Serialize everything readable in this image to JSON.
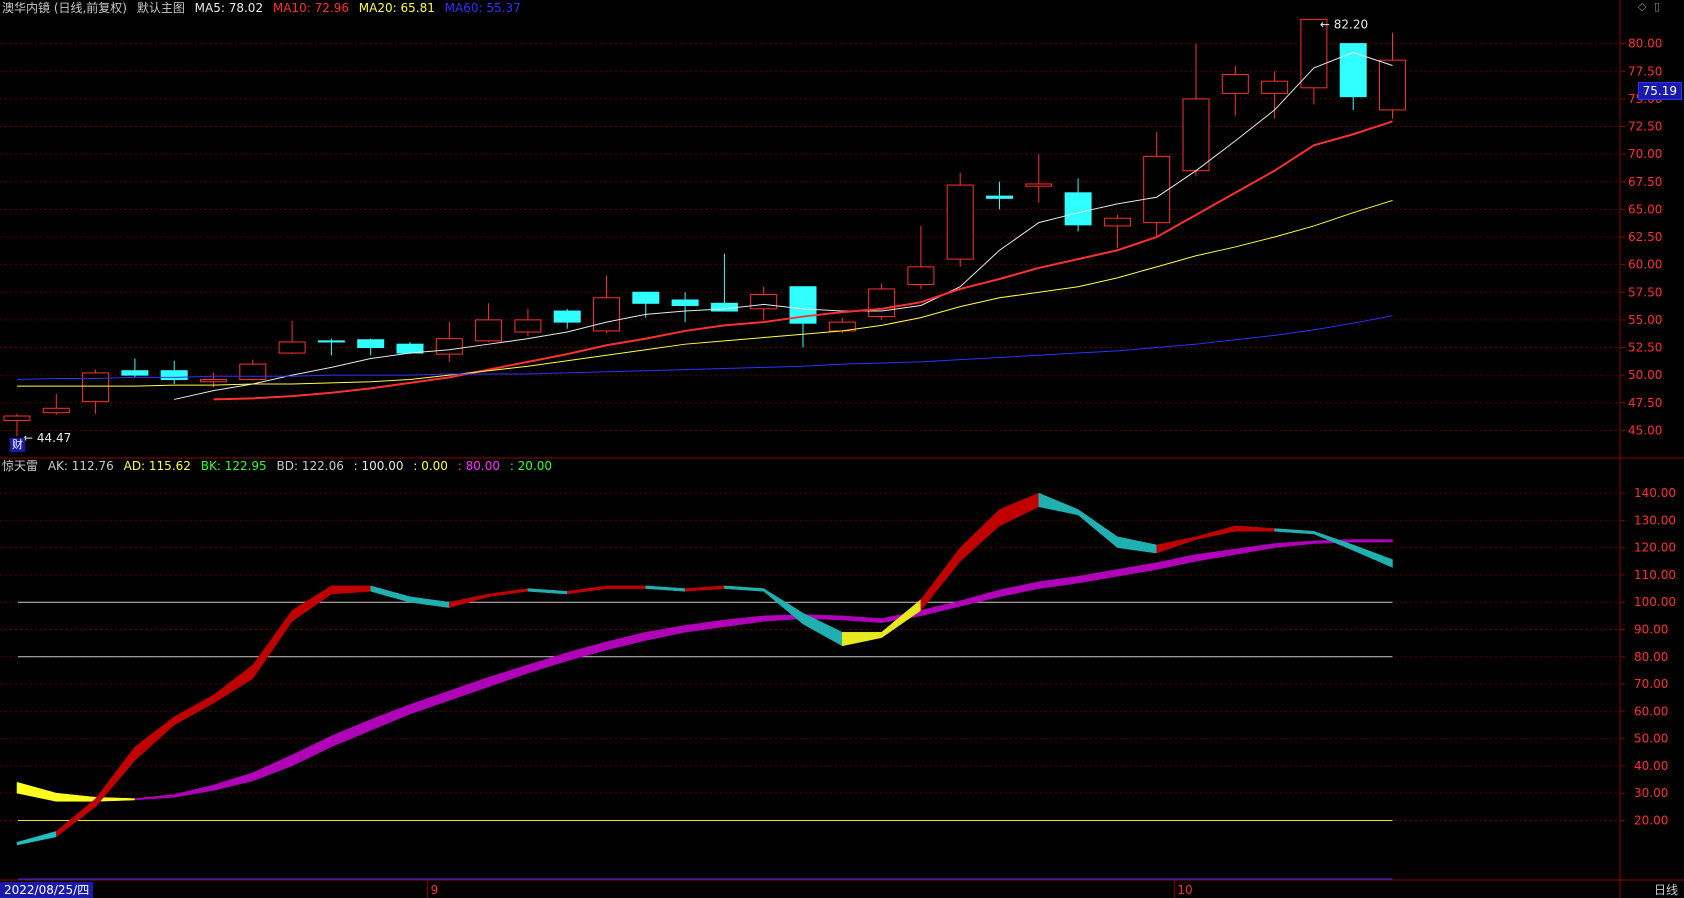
{
  "header": {
    "title": "澳华内镜 (日线,前复权)",
    "layout": "默认主图",
    "ma": [
      {
        "label": "MA5: 78.02",
        "color": "#e8e8e8"
      },
      {
        "label": "MA10: 72.96",
        "color": "#ff3030"
      },
      {
        "label": "MA20: 65.81",
        "color": "#ffff40"
      },
      {
        "label": "MA60: 55.37",
        "color": "#3030ff"
      }
    ]
  },
  "indicator_header": {
    "name": "惊天雷",
    "items": [
      {
        "label": "AK: 112.76",
        "color": "#c8c8c8"
      },
      {
        "label": "AD: 115.62",
        "color": "#ffff40"
      },
      {
        "label": "BK: 122.95",
        "color": "#30ff30"
      },
      {
        "label": "BD: 122.06",
        "color": "#c8c8c8"
      },
      {
        "label": ": 100.00",
        "color": "#e8e8e8"
      },
      {
        "label": ": 0.00",
        "color": "#ffff40"
      },
      {
        "label": ": 80.00",
        "color": "#ff30ff"
      },
      {
        "label": ": 20.00",
        "color": "#30ff30"
      }
    ]
  },
  "current_price": "75.19",
  "period": "日线",
  "cursor_date": "2022/08/25/四",
  "badge": "财",
  "colors": {
    "up": "#ff3030",
    "down": "#30ffff",
    "axis": "#8b0000",
    "grid": "#5a0000"
  },
  "chart_data": [
    {
      "type": "candlestick",
      "yaxis": {
        "min": 42.5,
        "max": 82.5,
        "ticks": [
          45.0,
          47.5,
          50.0,
          52.5,
          55.0,
          57.5,
          60.0,
          62.5,
          65.0,
          67.5,
          70.0,
          72.5,
          75.0,
          77.5,
          80.0
        ]
      },
      "x_labels": [
        {
          "index": 11,
          "label": "9"
        },
        {
          "index": 30,
          "label": "10"
        }
      ],
      "annotations": [
        {
          "index": 0,
          "value": 44.47,
          "label": "44.47"
        },
        {
          "index": 33,
          "value": 82.2,
          "label": "82.20"
        }
      ],
      "ohlc": [
        [
          45.9,
          46.5,
          44.47,
          46.3
        ],
        [
          46.6,
          48.3,
          46.4,
          47.0
        ],
        [
          47.6,
          50.5,
          46.5,
          50.2
        ],
        [
          50.4,
          51.5,
          49.8,
          50.0
        ],
        [
          50.4,
          51.3,
          49.2,
          49.6
        ],
        [
          49.4,
          50.2,
          48.9,
          49.6
        ],
        [
          49.6,
          51.4,
          49.5,
          51.0
        ],
        [
          52.0,
          54.9,
          51.9,
          53.0
        ],
        [
          53.1,
          53.3,
          51.8,
          53.0
        ],
        [
          53.2,
          53.3,
          51.8,
          52.5
        ],
        [
          52.8,
          53.0,
          51.9,
          52.0
        ],
        [
          51.9,
          54.8,
          51.2,
          53.3
        ],
        [
          53.1,
          56.5,
          53.0,
          55.0
        ],
        [
          53.9,
          56.0,
          53.5,
          55.0
        ],
        [
          55.8,
          56.0,
          54.2,
          54.8
        ],
        [
          54.0,
          59.0,
          53.8,
          57.0
        ],
        [
          57.5,
          57.5,
          55.2,
          56.5
        ],
        [
          56.8,
          57.5,
          54.8,
          56.3
        ],
        [
          56.5,
          61.0,
          56.0,
          55.8
        ],
        [
          56.0,
          58.0,
          55.0,
          57.3
        ],
        [
          58.0,
          58.0,
          52.5,
          54.7
        ],
        [
          54.0,
          55.2,
          53.8,
          54.8
        ],
        [
          55.3,
          58.3,
          55.0,
          57.8
        ],
        [
          58.2,
          63.5,
          57.8,
          59.8
        ],
        [
          60.5,
          68.3,
          59.8,
          67.2
        ],
        [
          66.2,
          67.5,
          65.0,
          66.0
        ],
        [
          67.1,
          70.0,
          65.6,
          67.3
        ],
        [
          66.5,
          67.8,
          63.0,
          63.6
        ],
        [
          63.5,
          64.5,
          61.5,
          64.2
        ],
        [
          63.8,
          72.0,
          62.5,
          69.8
        ],
        [
          68.5,
          80.0,
          68.0,
          75.0
        ],
        [
          75.5,
          78.0,
          73.5,
          77.2
        ],
        [
          75.5,
          77.5,
          73.2,
          76.6
        ],
        [
          76.0,
          82.2,
          74.5,
          82.2
        ],
        [
          80.0,
          79.5,
          74.0,
          75.2
        ],
        [
          74.0,
          81.0,
          73.2,
          78.5
        ]
      ],
      "series": [
        {
          "name": "MA5",
          "color": "#e8e8e8",
          "values": [
            null,
            null,
            null,
            null,
            47.8,
            48.6,
            49.2,
            50.0,
            50.7,
            51.5,
            52.0,
            52.3,
            52.8,
            53.3,
            53.9,
            54.8,
            55.5,
            55.8,
            56.0,
            56.4,
            56.0,
            55.8,
            55.8,
            56.3,
            58.0,
            61.3,
            63.8,
            64.7,
            65.5,
            66.1,
            68.5,
            71.2,
            74.0,
            77.8,
            79.2,
            78.02
          ]
        },
        {
          "name": "MA10",
          "color": "#ff3030",
          "values": [
            null,
            null,
            null,
            null,
            null,
            null,
            null,
            null,
            null,
            47.8,
            47.9,
            48.1,
            48.4,
            48.8,
            49.3,
            49.8,
            50.5,
            51.2,
            51.9,
            52.7,
            53.3,
            54.0,
            54.5,
            54.8,
            55.3,
            55.7,
            56.0,
            56.6,
            57.8,
            58.7,
            59.7,
            60.5,
            61.3,
            62.5,
            64.5,
            66.5,
            68.5,
            70.8,
            71.8,
            72.96
          ]
        },
        {
          "name": "MA20",
          "color": "#ffff40",
          "values": [
            49.0,
            49.0,
            49.0,
            49.0,
            49.1,
            49.1,
            49.2,
            49.2,
            49.3,
            49.4,
            49.6,
            50.0,
            50.4,
            50.8,
            51.3,
            51.8,
            52.3,
            52.8,
            53.1,
            53.4,
            53.7,
            54.0,
            54.5,
            55.2,
            56.2,
            57.0,
            57.5,
            58.0,
            58.8,
            59.8,
            60.8,
            61.6,
            62.5,
            63.5,
            64.7,
            65.81
          ]
        },
        {
          "name": "MA60",
          "color": "#3030ff",
          "values": [
            49.6,
            49.7,
            49.7,
            49.8,
            49.8,
            49.9,
            49.9,
            49.9,
            50.0,
            50.0,
            50.0,
            50.1,
            50.1,
            50.1,
            50.2,
            50.3,
            50.4,
            50.5,
            50.6,
            50.7,
            50.8,
            51.0,
            51.1,
            51.2,
            51.4,
            51.6,
            51.8,
            52.0,
            52.2,
            52.5,
            52.8,
            53.2,
            53.6,
            54.1,
            54.7,
            55.37
          ]
        }
      ]
    },
    {
      "type": "line",
      "name": "惊天雷",
      "yaxis": {
        "min": 0,
        "max": 147,
        "ticks": [
          20.0,
          30.0,
          40.0,
          50.0,
          60.0,
          70.0,
          80.0,
          90.0,
          100.0,
          110.0,
          120.0,
          130.0,
          140.0
        ]
      },
      "hlines": [
        {
          "value": 100,
          "color": "#c8c8c8"
        },
        {
          "value": 80,
          "color": "#c8c8c8"
        },
        {
          "value": 20,
          "color": "#e8e830"
        },
        {
          "value": 0,
          "color": "#3030ff"
        }
      ],
      "fast": {
        "a": [
          11,
          14,
          25,
          42,
          55,
          63,
          72,
          93,
          103,
          104,
          100,
          98,
          102,
          104,
          103,
          105,
          105,
          104,
          105,
          104,
          92,
          84,
          87,
          97,
          115,
          128,
          135,
          132,
          120,
          118,
          123,
          126,
          126,
          125,
          119,
          112.76
        ],
        "b": [
          12,
          16,
          28,
          47,
          58,
          66,
          77,
          97,
          106,
          106,
          102,
          100,
          103,
          105,
          104,
          106,
          106,
          105,
          106,
          105,
          96,
          89,
          89,
          101,
          120,
          134,
          140,
          134,
          124,
          121,
          124,
          128,
          127,
          126,
          121,
          115.62
        ]
      },
      "slow": {
        "a": [
          30,
          27,
          27,
          27.5,
          28.5,
          31,
          34.5,
          40,
          47,
          53,
          59,
          64,
          69,
          74,
          78.5,
          82.5,
          86,
          89,
          91,
          93,
          94,
          93.5,
          92.5,
          95,
          98.5,
          102,
          105,
          107,
          109.5,
          112,
          115,
          117.5,
          120,
          121.5,
          122,
          122.06
        ],
        "b": [
          34,
          30,
          28.5,
          28,
          29.5,
          33,
          37.5,
          44,
          51,
          57,
          62.5,
          67.5,
          72.5,
          77,
          81.5,
          85.5,
          89,
          91.5,
          93.5,
          95,
          95.5,
          95,
          94,
          97,
          100.5,
          104.5,
          107.5,
          109.5,
          112,
          114.5,
          117.5,
          119.5,
          121.5,
          122.5,
          123,
          122.95
        ]
      }
    }
  ]
}
